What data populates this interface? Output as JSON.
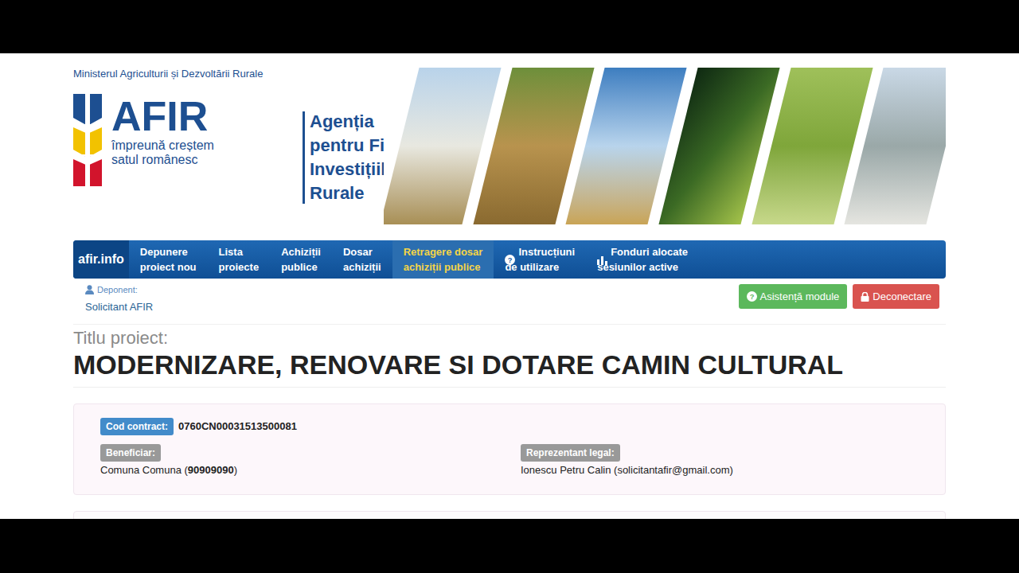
{
  "header": {
    "ministry": "Ministerul Agriculturii și Dezvoltării Rurale",
    "logo": "AFIR",
    "slogan": [
      "împreună creștem",
      "satul românesc"
    ],
    "agency": [
      "Agenția",
      "pentru Finanțarea",
      "Investițiilor",
      "Rurale"
    ]
  },
  "nav": {
    "brand": "afir.info",
    "items": [
      {
        "label": [
          "Depunere",
          "proiect nou"
        ],
        "selected": false,
        "kind": "plain"
      },
      {
        "label": [
          "Lista",
          "proiecte"
        ],
        "selected": false,
        "kind": "plain"
      },
      {
        "label": [
          "Achiziții",
          "publice"
        ],
        "selected": false,
        "kind": "plain"
      },
      {
        "label": [
          "Dosar",
          "achiziții"
        ],
        "selected": false,
        "kind": "plain"
      },
      {
        "label": [
          "Retragere dosar",
          "achiziții publice"
        ],
        "selected": true,
        "kind": "plain"
      },
      {
        "label": [
          "Instrucțiuni",
          "de utilizare"
        ],
        "selected": false,
        "kind": "help"
      },
      {
        "label": [
          "Fonduri alocate",
          "sesiunilor active"
        ],
        "selected": false,
        "kind": "chart"
      }
    ]
  },
  "user": {
    "label": "Deponent:",
    "name": "Solicitant AFIR"
  },
  "buttons": [
    {
      "label": "Asistență module",
      "kind": "help",
      "color": "#5cb85c"
    },
    {
      "label": "Deconectare",
      "kind": "lock",
      "color": "#d9534f"
    }
  ],
  "project": {
    "title_label": "Titlu proiect:",
    "title": "MODERNIZARE, RENOVARE SI DOTARE CAMIN CULTURAL"
  },
  "contract": {
    "code_label": "Cod contract:",
    "code": "0760CN00031513500081",
    "beneficiary_label": "Beneficiar:",
    "beneficiary_name": "Comuna Comuna (",
    "beneficiary_id": "90909090",
    "beneficiary_close": ")",
    "rep_label": "Reprezentant legal:",
    "rep": "Ionescu Petru Calin (solicitantafir@gmail.com)"
  }
}
